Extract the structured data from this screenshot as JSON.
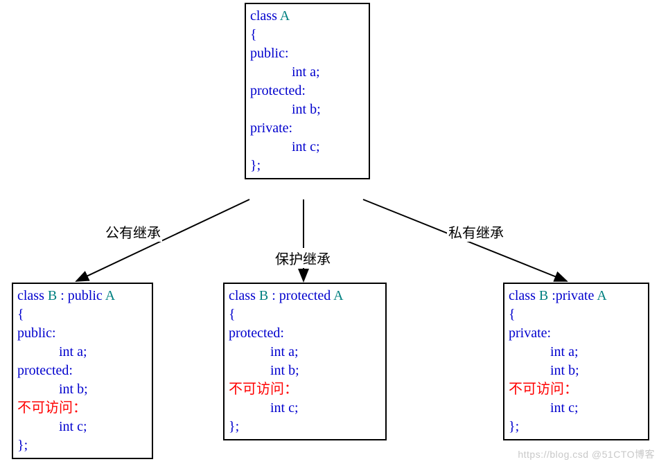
{
  "classA": {
    "decl_class": "class ",
    "decl_name": "A",
    "open": "{",
    "public_label": "public",
    "member_a": "int a;",
    "protected_label": "protected",
    "member_b": "int b;",
    "private_label": "private",
    "member_c": "int c;",
    "close": "};"
  },
  "labels": {
    "public_inherit": "公有继承",
    "protected_inherit": "保护继承",
    "private_inherit": "私有继承"
  },
  "classB_public": {
    "decl_class": "class ",
    "decl_name": "B",
    "decl_sep": " : ",
    "decl_mod": "public ",
    "decl_base": "A",
    "open": "{",
    "public_label": "public",
    "member_a": "int a;",
    "protected_label": "protected",
    "member_b": "int b;",
    "inaccessible": "不可访问：",
    "member_c": "int c;",
    "close": "};"
  },
  "classB_protected": {
    "decl_class": "class ",
    "decl_name": "B",
    "decl_sep": " : ",
    "decl_mod": "protected ",
    "decl_base": "A",
    "open": "{",
    "protected_label": "protected",
    "member_a": "int a;",
    "member_b": "int b;",
    "inaccessible": "不可访问：",
    "member_c": "int c;",
    "close": "};"
  },
  "classB_private": {
    "decl_class": "class ",
    "decl_name": "B",
    "decl_sep": " :",
    "decl_mod": "private ",
    "decl_base": "A",
    "open": "{",
    "private_label": "private",
    "member_a": "int a;",
    "member_b": "int b;",
    "inaccessible": "不可访问：",
    "member_c": "int c;",
    "close": "};"
  },
  "watermark": "https://blog.csd  @51CTO博客"
}
